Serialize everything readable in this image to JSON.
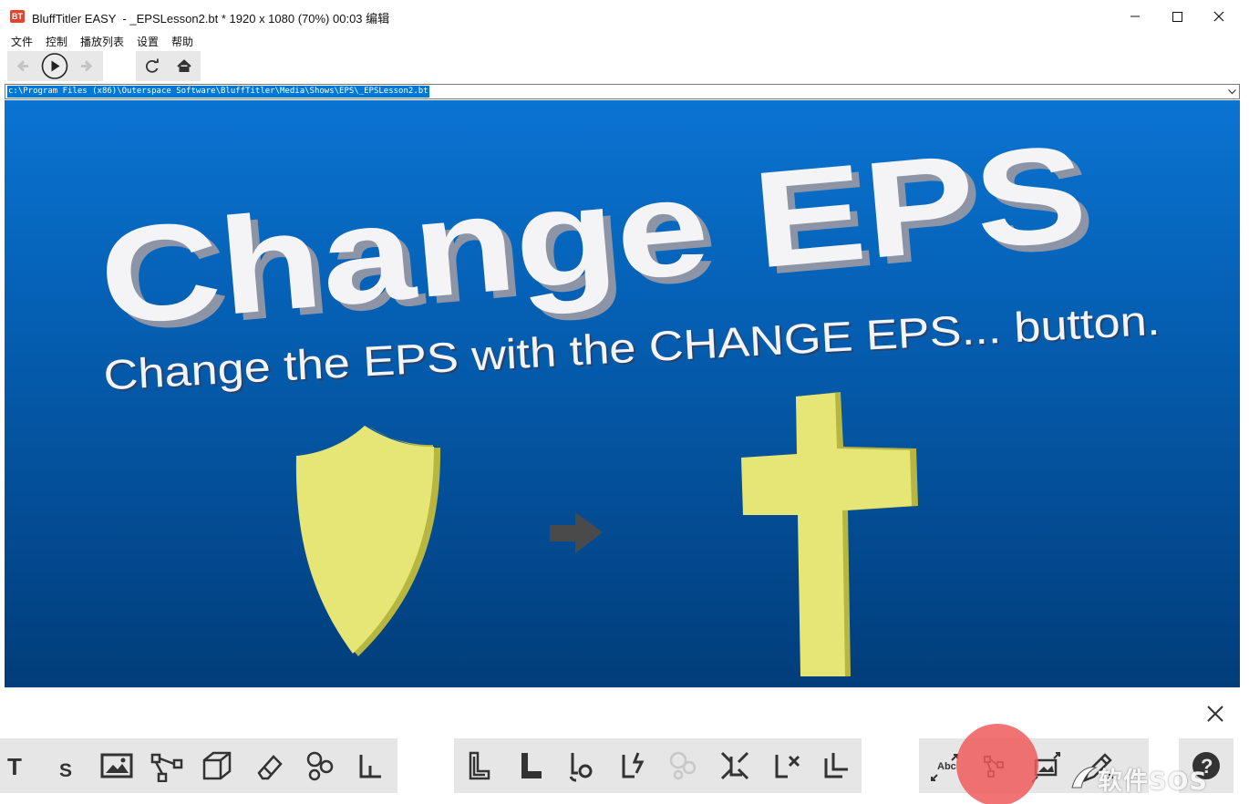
{
  "window": {
    "app_logo_text": "BT",
    "title": "BluffTitler EASY  - _EPSLesson2.bt * 1920 x 1080 (70%) 00:03 编辑"
  },
  "menu": {
    "items": [
      "文件",
      "控制",
      "播放列表",
      "设置",
      "帮助"
    ]
  },
  "toolbar": {
    "icons": [
      "back-arrow-icon",
      "play-icon",
      "forward-arrow-icon",
      "refresh-icon",
      "home-icon"
    ]
  },
  "path": {
    "value": "c:\\Program Files (x86)\\Outerspace Software\\BluffTitler\\Media\\Shows\\EPS\\_EPSLesson2.bt"
  },
  "preview": {
    "headline": "Change EPS",
    "subtitle": "Change the EPS with the CHANGE EPS... button.",
    "colors": {
      "background_top": "#0a74d2",
      "background_bottom": "#023d7a",
      "text": "#f4f4f6",
      "text_shadow": "#8d94a6",
      "shape_face": "#e6e676",
      "shape_side": "#b6b640",
      "arrow": "#4a4a4a"
    }
  },
  "bottom_toolbar": {
    "layer_icons": [
      "text-layer-icon",
      "subtitle-layer-icon",
      "picture-layer-icon",
      "eps-layer-icon",
      "model-layer-icon",
      "eraser-icon",
      "particles-icon",
      "light-layer-icon"
    ],
    "layer_labels": {
      "text": "T",
      "subtitle": "S"
    },
    "action_icons": [
      "add-layer-icon",
      "insert-layer-icon",
      "link-layer-icon",
      "effect-layer-icon",
      "hide-layer-icon",
      "merge-layer-icon",
      "delete-layer-icon",
      "copy-layer-icon"
    ],
    "object_icons": [
      "change-font-icon",
      "change-eps-icon",
      "change-picture-icon",
      "edit-icon"
    ],
    "object_labels": {
      "font_sample": "Abc"
    },
    "help_icon": "help-icon"
  },
  "watermark": {
    "text": "软件SOS"
  }
}
